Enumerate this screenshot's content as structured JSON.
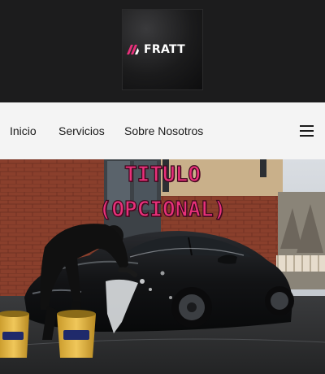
{
  "brand": {
    "name": "FRATT",
    "logo_icon": "fratt-logo-mark",
    "accent": "#e8307a"
  },
  "nav": {
    "items": [
      {
        "label": "Inicio"
      },
      {
        "label": "Servicios"
      },
      {
        "label": "Sobre Nosotros"
      }
    ],
    "menu_icon": "hamburger-menu-icon"
  },
  "hero": {
    "title_line1": "TITULO",
    "title_line2": "(OPCIONAL)",
    "bucket_label": "Meguiar's"
  }
}
